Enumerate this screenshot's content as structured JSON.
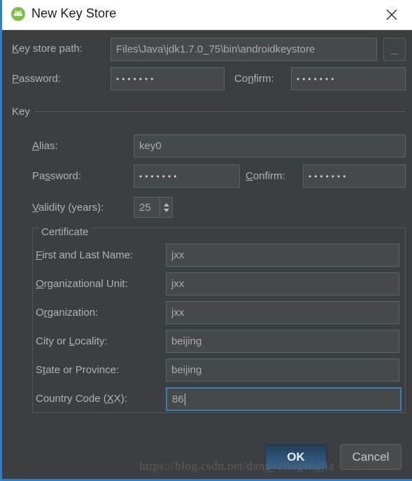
{
  "window": {
    "title": "New Key Store",
    "icon": "android-studio-icon",
    "close_icon": "close-icon"
  },
  "keystore": {
    "path_label": "Key store path:",
    "path_label_mnemonic": "K",
    "path_value": "Files\\Java\\jdk1.7.0_75\\bin\\androidkeystore",
    "browse_label": "...",
    "password_label": "Password:",
    "password_label_mnemonic": "P",
    "password_value": "•••••••",
    "confirm_label": "Confirm:",
    "confirm_label_mnemonic": "n",
    "confirm_value": "•••••••"
  },
  "key_section": {
    "title": "Key",
    "alias_label": "Alias:",
    "alias_label_mnemonic": "A",
    "alias_value": "key0",
    "password_label": "Password:",
    "password_label_mnemonic": "s",
    "password_value": "•••••••",
    "confirm_label": "Confirm:",
    "confirm_label_mnemonic": "C",
    "confirm_value": "•••••••",
    "validity_label": "Validity (years):",
    "validity_label_mnemonic": "V",
    "validity_value": "25"
  },
  "certificate": {
    "title": "Certificate",
    "fields": [
      {
        "label": "First and Last Name:",
        "mnemonic": "F",
        "value": "jxx",
        "focused": false
      },
      {
        "label": "Organizational Unit:",
        "mnemonic": "O",
        "value": "jxx",
        "focused": false
      },
      {
        "label": "Organization:",
        "mnemonic": "r",
        "value": "jxx",
        "focused": false
      },
      {
        "label": "City or Locality:",
        "mnemonic": "L",
        "value": "beijing",
        "focused": false
      },
      {
        "label": "State or Province:",
        "mnemonic": "t",
        "value": "beijing",
        "focused": false
      },
      {
        "label": "Country Code (XX):",
        "mnemonic": "X",
        "value": "86",
        "focused": true
      }
    ]
  },
  "footer": {
    "ok_label": "OK",
    "cancel_label": "Cancel"
  },
  "watermark": {
    "text": "https://blog.csdn.net/dangyalingengjia"
  },
  "colors": {
    "dialog_background": "#3c3f41",
    "titlebar_background": "#ffffff",
    "field_background": "#45494a",
    "accent_blue": "#2f7fc6",
    "focus_border": "#3d7bb5",
    "label_text": "#b0b3b5"
  }
}
